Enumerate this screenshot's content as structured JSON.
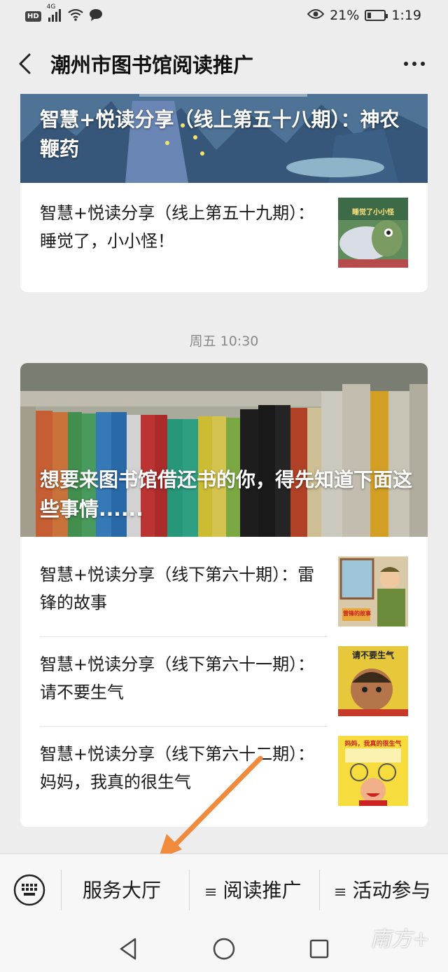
{
  "status_bar": {
    "hd": "HD",
    "net": "4G",
    "battery_percent": "21%",
    "battery_level": 0.21,
    "time": "1:19"
  },
  "nav": {
    "title": "潮州市图书馆阅读推广",
    "back_icon": "chevron-left-icon",
    "more_icon": "more-horizontal-icon"
  },
  "messages": [
    {
      "cover_title": "智慧+悦读分享（线上第五十八期）：神农鞭药",
      "items": [
        {
          "title": "智慧+悦读分享（线上第五十九期）：睡觉了，小小怪！",
          "thumb_text": "睡觉了小小怪"
        }
      ]
    },
    {
      "timestamp": "周五 10:30",
      "cover_title": "想要来图书馆借还书的你，得先知道下面这些事情......",
      "items": [
        {
          "title": "智慧+悦读分享（线下第六十期）：雷锋的故事",
          "thumb_text": "雷锋的故事"
        },
        {
          "title": "智慧+悦读分享（线下第六十一期）：请不要生气",
          "thumb_text": "请不要生气"
        },
        {
          "title": "智慧+悦读分享（线下第六十二期）：妈妈，我真的很生气",
          "thumb_text": "妈妈，我真的很生气"
        }
      ]
    }
  ],
  "menu": {
    "keyboard_icon": "keyboard-icon",
    "items": [
      "服务大厅",
      "阅读推广",
      "活动参与"
    ],
    "submenu_icon": "≡"
  },
  "watermark": "南方+",
  "colors": {
    "background": "#ededed",
    "card": "#ffffff",
    "arrow": "#f08a3c"
  }
}
